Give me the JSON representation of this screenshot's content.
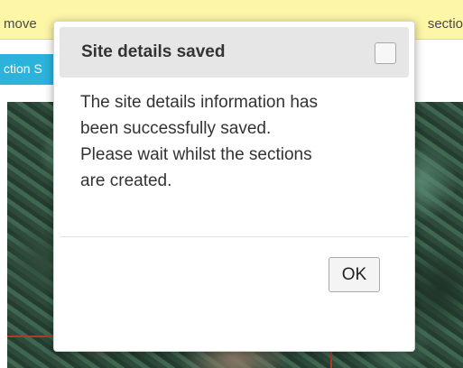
{
  "background": {
    "banner_left_text": "move",
    "banner_right_text": "sectio",
    "teal_button_label": "ction S"
  },
  "dialog": {
    "title": "Site details saved",
    "message_lines": [
      "The site details information has",
      "been successfully saved.",
      "Please wait whilst the sections",
      "are created."
    ],
    "ok_label": "OK"
  },
  "colors": {
    "banner": "#fdf6a6",
    "teal_button": "#2bb3dc",
    "dialog_header": "#e6e6e6"
  }
}
